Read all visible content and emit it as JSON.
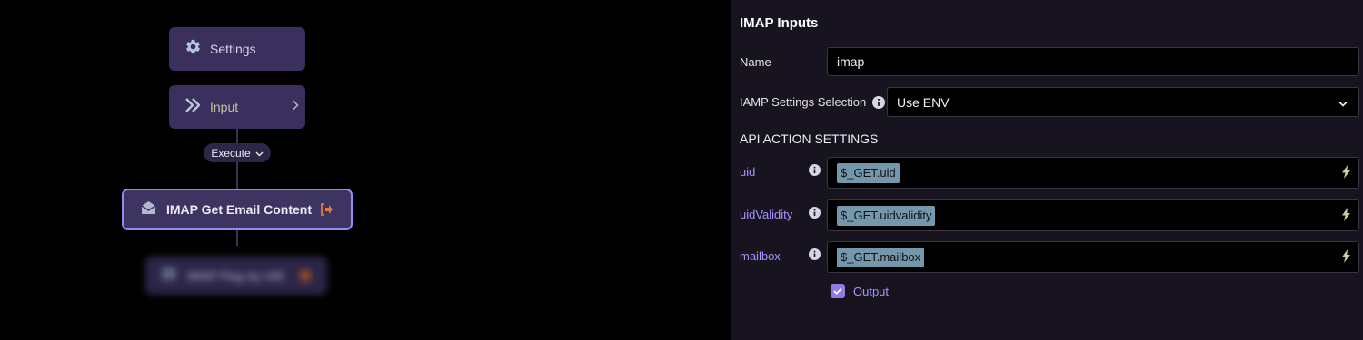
{
  "canvas": {
    "settings_node": {
      "label": "Settings",
      "icon": "gear-icon"
    },
    "input_node": {
      "label": "Input",
      "icon": "double-chevron-right-icon"
    },
    "execute_pill": {
      "label": "Execute",
      "icon": "chevron-down-icon"
    },
    "main_node": {
      "label": "IMAP Get Email Content",
      "icon": "envelope-open-icon",
      "exit_icon": "exit-icon"
    },
    "blurred_node": {
      "label": "IMAP Flag by UID"
    }
  },
  "panel": {
    "title": "IMAP Inputs",
    "name_field": {
      "label": "Name",
      "value": "imap"
    },
    "settings_selection": {
      "label": "IAMP Settings Selection",
      "value": "Use ENV"
    },
    "api_section_title": "API ACTION SETTINGS",
    "params": [
      {
        "label": "uid",
        "value": "$_GET.uid"
      },
      {
        "label": "uidValidity",
        "value": "$_GET.uidvalidity"
      },
      {
        "label": "mailbox",
        "value": "$_GET.mailbox"
      }
    ],
    "output": {
      "label": "Output",
      "checked": true
    }
  },
  "colors": {
    "accent": "#9c87f0",
    "param_label": "#a894ff",
    "chip": "#7597ab",
    "node_bg": "#3b2f5e"
  }
}
